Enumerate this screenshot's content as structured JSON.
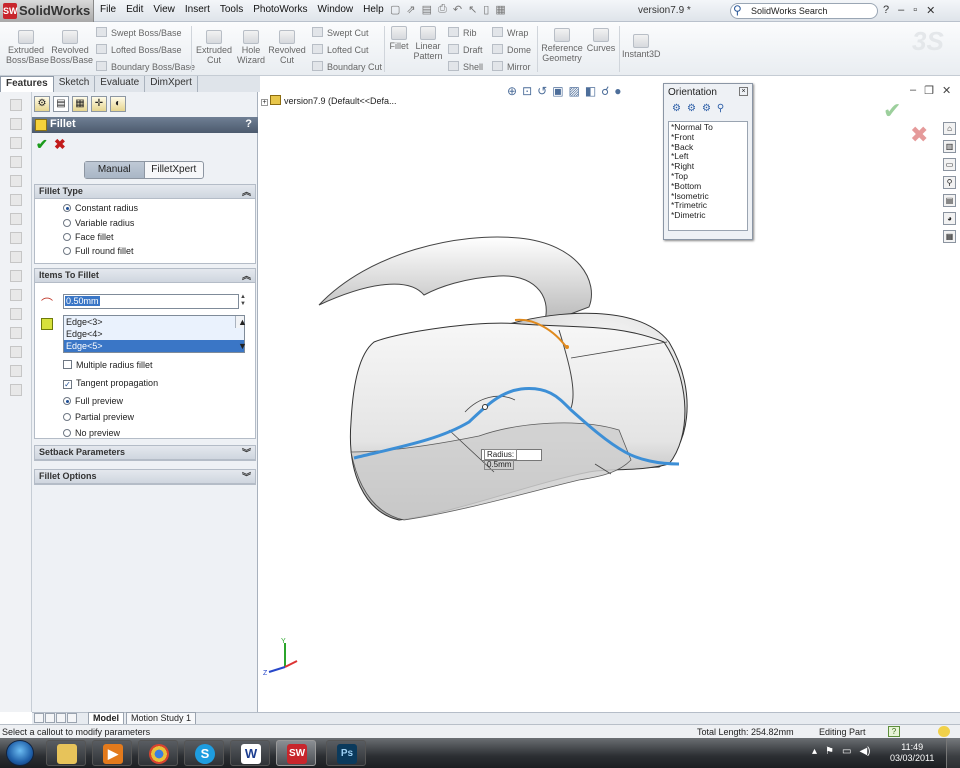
{
  "app": {
    "logo_mark": "SW",
    "name": "SolidWorks",
    "doc_title": "version7.9 *"
  },
  "menu": [
    "File",
    "Edit",
    "View",
    "Insert",
    "Tools",
    "PhotoWorks",
    "Window",
    "Help"
  ],
  "search": {
    "placeholder": "SolidWorks Search"
  },
  "ribbon": {
    "extruded_boss": "Extruded Boss/Base",
    "revolved_boss": "Revolved Boss/Base",
    "swept_boss": "Swept Boss/Base",
    "lofted_boss": "Lofted Boss/Base",
    "boundary_boss": "Boundary Boss/Base",
    "extruded_cut": "Extruded Cut",
    "hole_wizard": "Hole Wizard",
    "revolved_cut": "Revolved Cut",
    "swept_cut": "Swept Cut",
    "lofted_cut": "Lofted Cut",
    "boundary_cut": "Boundary Cut",
    "fillet": "Fillet",
    "linear_pattern": "Linear Pattern",
    "rib": "Rib",
    "draft": "Draft",
    "shell": "Shell",
    "wrap": "Wrap",
    "dome": "Dome",
    "mirror": "Mirror",
    "reference_geometry": "Reference Geometry",
    "curves": "Curves",
    "instant3d": "Instant3D"
  },
  "tabs": [
    "Features",
    "Sketch",
    "Evaluate",
    "DimXpert"
  ],
  "property_manager": {
    "title": "Fillet",
    "help": "?",
    "modes": [
      "Manual",
      "FilletXpert"
    ],
    "fillet_type": {
      "header": "Fillet Type",
      "options": [
        "Constant radius",
        "Variable radius",
        "Face fillet",
        "Full round fillet"
      ],
      "selected": "Constant radius"
    },
    "items_to_fillet": {
      "header": "Items To Fillet",
      "radius_value": "0.50mm",
      "edges": [
        "Edge<3>",
        "Edge<4>",
        "Edge<5>"
      ],
      "selected_edge": "Edge<5>",
      "multiple_radius": "Multiple radius fillet",
      "tangent_propagation": "Tangent propagation",
      "preview_options": [
        "Full preview",
        "Partial preview",
        "No preview"
      ],
      "selected_preview": "Full preview"
    },
    "setback_header": "Setback Parameters",
    "fillet_options_header": "Fillet Options"
  },
  "viewport": {
    "tree_label": "version7.9  (Default<<Defa...",
    "radius_callout_label": "Radius:",
    "radius_callout_value": "0.5mm",
    "triad": {
      "y": "Y",
      "z": "Z"
    }
  },
  "orientation": {
    "title": "Orientation",
    "views": [
      "*Normal To",
      "*Front",
      "*Back",
      "*Left",
      "*Right",
      "*Top",
      "*Bottom",
      "*Isometric",
      "*Trimetric",
      "*Dimetric"
    ]
  },
  "bottom_tabs": [
    "Model",
    "Motion Study 1"
  ],
  "status": {
    "message": "Select a callout to modify parameters",
    "total_length": "Total Length: 254.82mm",
    "mode": "Editing Part",
    "help_icon": "?"
  },
  "taskbar": {
    "apps": [
      "Windows Explorer",
      "Media Player",
      "Chrome",
      "Skype",
      "Word",
      "SolidWorks",
      "Photoshop"
    ],
    "word_glyph": "W",
    "solidworks_glyph": "SW",
    "photoshop_glyph": "Ps",
    "skype_glyph": "S",
    "time": "11:49",
    "date": "03/03/2011"
  },
  "colors": {
    "fillet_preview_blue": "#3d8fd6",
    "selected_edge_orange": "#e08a1e",
    "title_bar": "#5a6a7e",
    "selection_blue": "#3a76c6"
  }
}
